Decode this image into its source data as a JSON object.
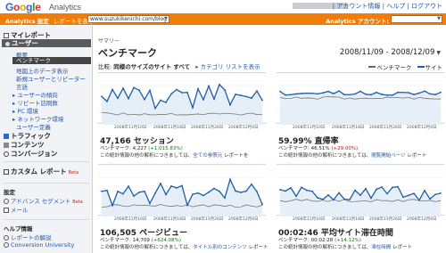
{
  "header": {
    "logo_google": [
      "G",
      "o",
      "o",
      "g",
      "l",
      "e"
    ],
    "logo_analytics": "Analytics",
    "links": "| アカウント情報 | ヘルプ | ログアウト"
  },
  "orangebar": {
    "settings": "Analytics 設定",
    "report_label": "レポートを表示:",
    "report_value": "www.suzukikenichi.com/blog",
    "account_label": "Analytics アカウント:"
  },
  "sidebar": {
    "my_report": "マイレポート",
    "users": "ユーザー",
    "users_items": [
      "概要",
      "ベンチマーク",
      "地図上のデータ表示",
      "新規ユーザーとリピーター",
      "言語",
      "ユーザーの傾向",
      "リピート訪問数",
      "PC 環境",
      "ネットワーク環境",
      "ユーザー定義"
    ],
    "active_item": "ベンチマーク",
    "traffic": "トラフィック",
    "content": "コンテンツ",
    "conversion": "コンバージョン",
    "custom_report": "カスタム レポート",
    "beta": "Beta",
    "settings_head": "設定",
    "advanced_segment": "アドバンス セグメント",
    "email": "メール",
    "help_head": "ヘルプ情報",
    "help_items": [
      "レポートの解説",
      "Conversion University"
    ]
  },
  "main": {
    "breadcrumb": "サマリー",
    "title": "ベンチマーク",
    "date_range": "2008/11/09 - 2008/12/09",
    "compare_prefix": "比較:",
    "compare_bold": "同様のサイズのサイト すべて",
    "compare_link": "カテゴリ リストを表示",
    "legend_bench": "ベンチマーク",
    "legend_site": "サイト"
  },
  "panels": [
    {
      "value": "47,166 セッション",
      "sub_label": "ベンチマーク: 4,227",
      "sub_change": "(+1,015.83%)",
      "change_color": "green",
      "desc_text": "この統計情報の他の解析につきましては、",
      "desc_link": "全ての参照元",
      "desc_tail": " レポートを",
      "ticks": [
        "2008年11月10日",
        "2008年11月18日",
        "2008年11月26日",
        "2008年12月4日"
      ],
      "ymarks": [
        "3,000",
        "1,500"
      ],
      "chart_kind": "spiky_high"
    },
    {
      "value": "59.99% 直帰率",
      "sub_label": "ベンチマーク: 46.51%",
      "sub_change": "(+29.00%)",
      "change_color": "red",
      "desc_text": "この統計情報の他の解析につきましては、",
      "desc_link": "閲覧開始ページ",
      "desc_tail": " レポート",
      "ticks": [
        "2008年11月10日",
        "2008年11月18日",
        "2008年11月26日",
        "2008年12月4日"
      ],
      "ymarks": [
        "100%",
        "50%"
      ],
      "chart_kind": "flat"
    },
    {
      "value": "106,505 ページビュー",
      "sub_label": "ベンチマーク: 14,709",
      "sub_change": "(+624.08%)",
      "change_color": "green",
      "desc_text": "この統計情報の他の解析につきましては、",
      "desc_link": "タイトル別のコンテンツ",
      "desc_tail": " レポート",
      "ticks": [
        "2008年11月10日",
        "2008年11月18日",
        "2008年11月26日",
        "2008年12月4日"
      ],
      "ymarks": [
        "6,000",
        "3,000"
      ],
      "chart_kind": "spiky_mid"
    },
    {
      "value": "00:02:46 平均サイト滞在時間",
      "sub_label": "ベンチマーク: 00:02:28",
      "sub_change": "(+14.12%)",
      "change_color": "green",
      "desc_text": "この統計情報の他の解析につきましては、",
      "desc_link": "滞在時間",
      "desc_tail": " レポート",
      "ticks": [
        "2008年11月10日",
        "2008年11月18日",
        "2008年11月26日",
        "2008年12月4日"
      ],
      "ymarks": [
        "00:05:00",
        "00:02:30"
      ],
      "chart_kind": "time"
    }
  ],
  "colors": {
    "orange": "#f07c0a",
    "site_line": "#1f5fa8",
    "bench_line": "#666666",
    "green": "#117711",
    "red": "#cc1111"
  }
}
